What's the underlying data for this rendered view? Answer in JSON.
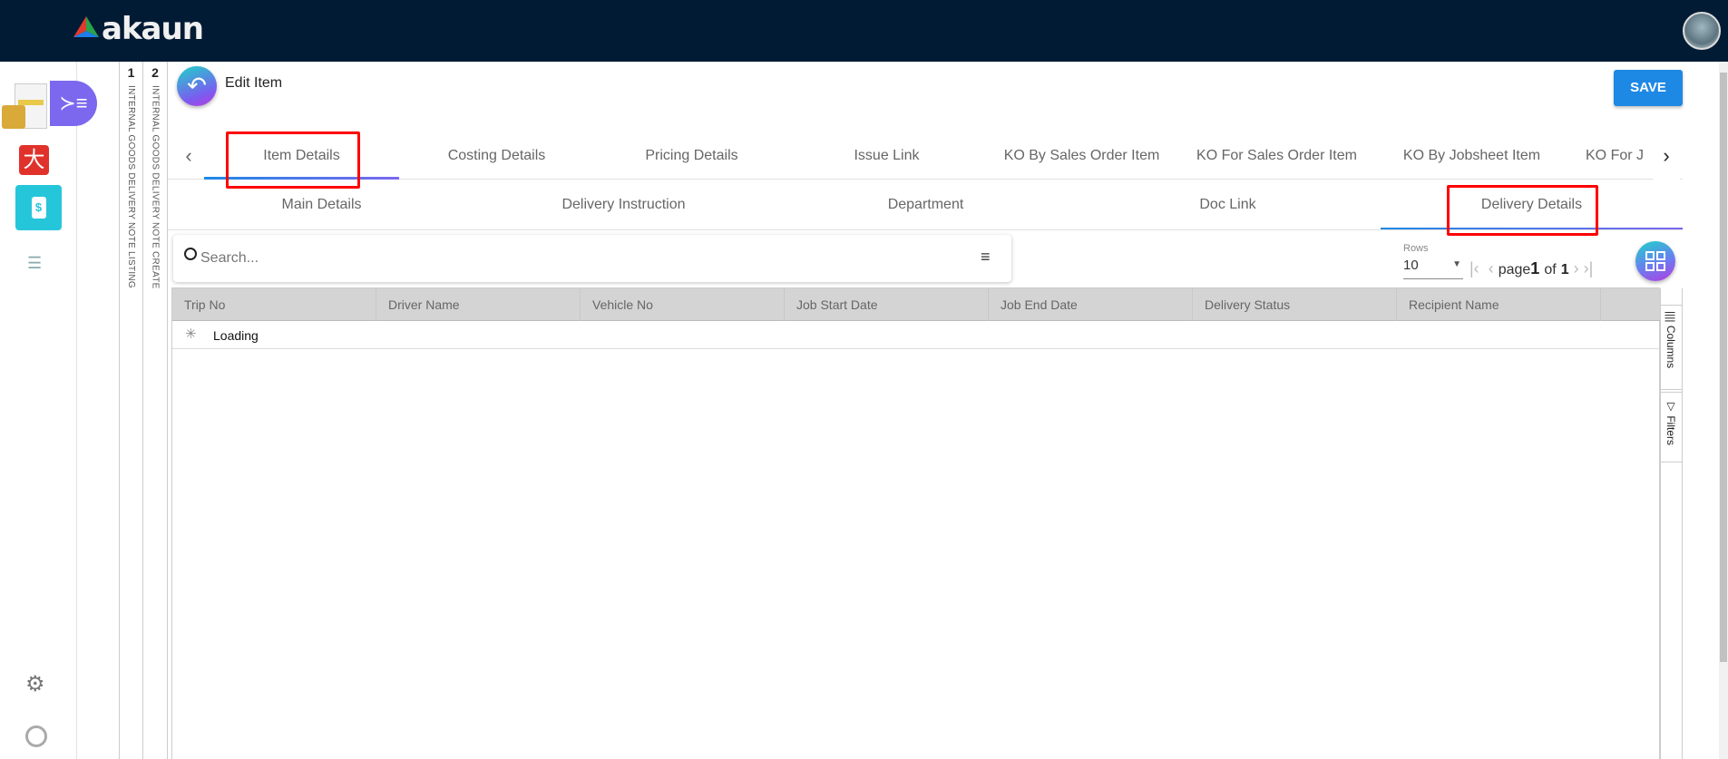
{
  "header": {
    "logo_text": "akaun",
    "avatar": "user-avatar"
  },
  "sidebar": {
    "items": [
      "delivery-note-app",
      "red-app",
      "cash-app",
      "list-menu",
      "settings",
      "profile"
    ]
  },
  "panels": [
    {
      "num": "1",
      "title": "INTERNAL GOODS DELIVERY NOTE LISTING"
    },
    {
      "num": "2",
      "title": "INTERNAL GOODS DELIVERY NOTE CREATE"
    }
  ],
  "page": {
    "title": "Edit Item",
    "save_label": "SAVE"
  },
  "tabs": [
    "Item Details",
    "Costing Details",
    "Pricing Details",
    "Issue Link",
    "KO By Sales Order Item",
    "KO For Sales Order Item",
    "KO By Jobsheet Item",
    "KO For J"
  ],
  "subtabs": [
    "Main Details",
    "Delivery Instruction",
    "Department",
    "Doc Link",
    "Delivery Details"
  ],
  "search": {
    "placeholder": "Search..."
  },
  "pagination": {
    "rows_label": "Rows",
    "rows_value": "10",
    "page_word": "page",
    "page": "1",
    "of_word": "of",
    "total": "1"
  },
  "table": {
    "columns": [
      "Trip No",
      "Driver Name",
      "Vehicle No",
      "Job Start Date",
      "Job End Date",
      "Delivery Status",
      "Recipient Name"
    ],
    "loading": "Loading"
  },
  "side_panel": {
    "columns": "Columns",
    "filters": "Filters"
  },
  "colors": {
    "header": "#021b35",
    "accent": "#1e88e5",
    "highlight": "#ff0000"
  }
}
